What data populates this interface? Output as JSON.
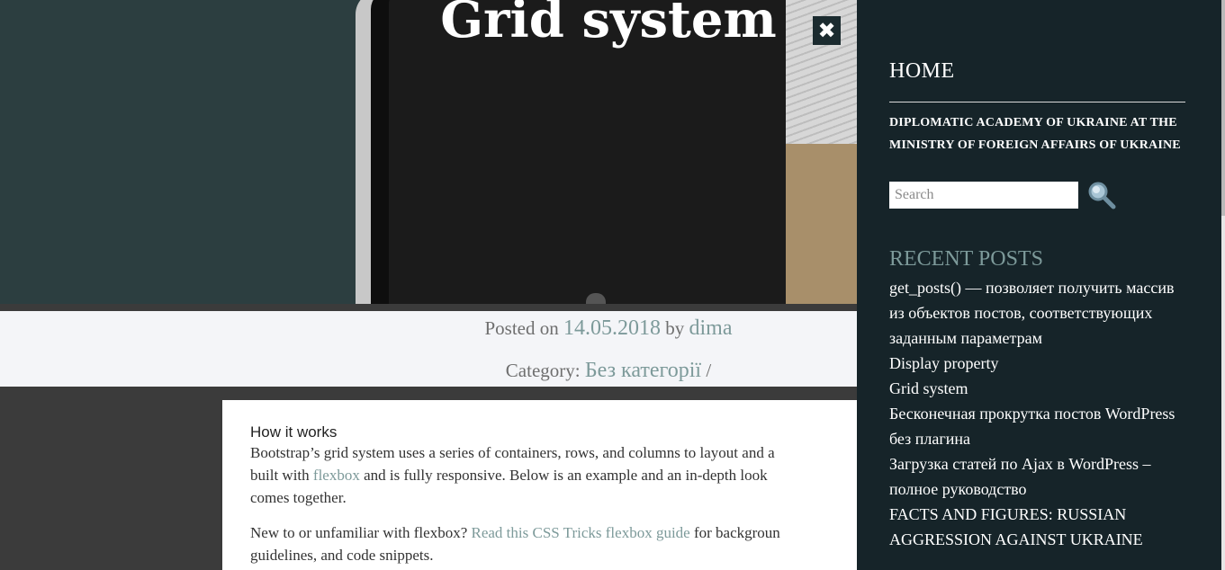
{
  "post": {
    "title": "Grid system",
    "meta": {
      "posted_on_label": "Posted on",
      "date": "14.05.2018",
      "by_label": "by",
      "author": "dima",
      "category_label": "Category:",
      "category": "Без категорії",
      "category_separator": "/"
    },
    "content": {
      "heading": "How it works",
      "p1_before_link": "Bootstrap’s grid system uses a series of containers, rows, and columns to layout and a",
      "p1_line2_before_link": "built with ",
      "p1_link": "flexbox",
      "p1_after_link": " and is fully responsive. Below is an example and an in-depth look",
      "p1_line3": "comes together.",
      "p2_before_link": "New to or unfamiliar with flexbox? ",
      "p2_link": "Read this CSS Tricks flexbox guide",
      "p2_after_link": " for backgroun",
      "p2_line2": "guidelines, and code snippets."
    }
  },
  "close_button": {
    "icon": "close-icon",
    "glyph": "✖"
  },
  "sidebar": {
    "home_label": "HOME",
    "site_description": "DIPLOMATIC ACADEMY OF UKRAINE AT THE MINISTRY OF FOREIGN AFFAIRS OF UKRAINE",
    "search": {
      "placeholder": "Search",
      "value": "",
      "icon": "search-icon"
    },
    "recent_posts_title": "RECENT POSTS",
    "recent_posts": [
      "get_posts() — позволяет получить массив из объектов постов, соответствующих заданным параметрам",
      "Display property",
      "Grid system",
      "Бесконечная прокрутка постов WordPress без плагина",
      "Загрузка статей по Ajax в WordPress – полное руководство",
      "FACTS AND FIGURES: RUSSIAN AGGRESSION AGAINST UKRAINE"
    ]
  },
  "colors": {
    "accent": "#7d9a9a",
    "sidebar_bg": "#162429",
    "hero_bg": "#2c3e40",
    "page_bg": "#3b3b3b",
    "meta_bg": "#f4f5f8"
  }
}
